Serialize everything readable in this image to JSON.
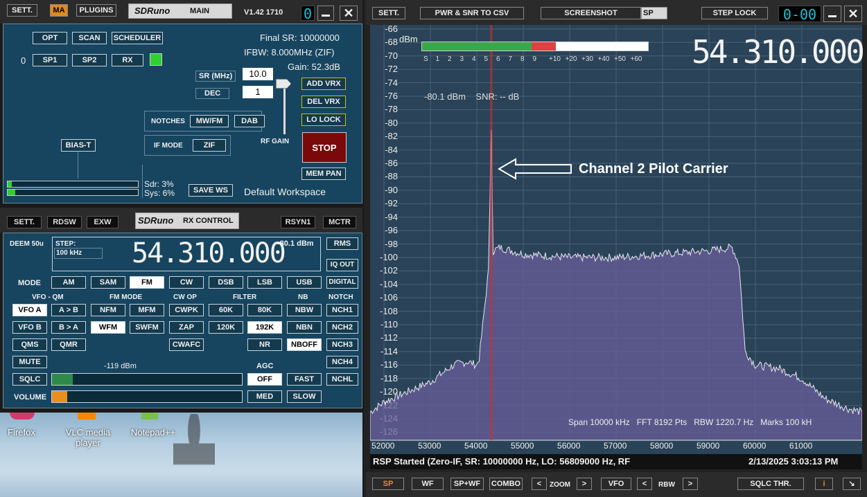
{
  "main": {
    "sett": "SETT.",
    "ma": "MA",
    "plugins": "PLUGINS",
    "logo": "SDRuno",
    "title": "MAIN",
    "version": "V1.42 1710",
    "counter": "0",
    "opt": "OPT",
    "scan": "SCAN",
    "scheduler": "SCHEDULER",
    "index": "0",
    "sp1": "SP1",
    "sp2": "SP2",
    "rx": "RX",
    "final_sr": "Final SR: 10000000",
    "ifbw": "IFBW: 8.000MHz (ZIF)",
    "gain": "Gain: 52.3dB",
    "sr_label": "SR (MHz)",
    "sr_value": "10.0",
    "dec_label": "DEC",
    "dec_value": "1",
    "add_vrx": "ADD VRX",
    "del_vrx": "DEL VRX",
    "lo_lock": "LO LOCK",
    "notches": "NOTCHES",
    "mwfm": "MW/FM",
    "dab": "DAB",
    "ifmode": "IF MODE",
    "zif": "ZIF",
    "rf_gain": "RF GAIN",
    "stop": "STOP",
    "bias_t": "BIAS-T",
    "mem_pan": "MEM PAN",
    "sdr_usage": "Sdr: 3%",
    "sys_usage": "Sys: 6%",
    "save_ws": "SAVE WS",
    "workspace": "Default Workspace"
  },
  "rxc": {
    "sett": "SETT.",
    "rdsw": "RDSW",
    "exw": "EXW",
    "logo": "SDRuno",
    "title": "RX CONTROL",
    "rsyn1": "RSYN1",
    "mctr": "MCTR",
    "deem": "DEEM 50u",
    "step_label": "STEP:",
    "step_value": "100 kHz",
    "freq": "54.310.000",
    "level": "-80.1 dBm",
    "rms": "RMS",
    "iq_out": "IQ OUT",
    "digital": "DIGITAL",
    "mode_label": "MODE",
    "modes": [
      "AM",
      "SAM",
      "FM",
      "CW",
      "DSB",
      "LSB",
      "USB"
    ],
    "h_vfo_qm": "VFO - QM",
    "h_fm_mode": "FM MODE",
    "h_cw_op": "CW OP",
    "h_filter": "FILTER",
    "h_nb": "NB",
    "h_notch": "NOTCH",
    "vfo_a": "VFO A",
    "a_to_b": "A > B",
    "nfm": "NFM",
    "mfm": "MFM",
    "cwpk": "CWPK",
    "f60k": "60K",
    "f80k": "80K",
    "nbw": "NBW",
    "nch1": "NCH1",
    "vfo_b": "VFO B",
    "b_to_a": "B > A",
    "wfm": "WFM",
    "swfm": "SWFM",
    "zap": "ZAP",
    "f120k": "120K",
    "f192k": "192K",
    "nbn": "NBN",
    "nch2": "NCH2",
    "qms": "QMS",
    "qmr": "QMR",
    "cwafc": "CWAFC",
    "nr": "NR",
    "nboff": "NBOFF",
    "nch3": "NCH3",
    "mute": "MUTE",
    "sq_level": "-119 dBm",
    "agc": "AGC",
    "nch4": "NCH4",
    "sqlc": "SQLC",
    "agc_off": "OFF",
    "agc_fast": "FAST",
    "nchl": "NCHL",
    "volume": "VOLUME",
    "agc_med": "MED",
    "agc_slow": "SLOW"
  },
  "desktop": {
    "firefox": "Firefox",
    "vlc": "VLC media player",
    "notepad": "Notepad++"
  },
  "sp": {
    "sett": "SETT.",
    "pwr_snr": "PWR & SNR TO CSV",
    "screenshot": "SCREENSHOT",
    "sp_tag": "SP",
    "step_lock": "STEP LOCK",
    "counter": "0-00",
    "dbm_unit": "dBm",
    "big_freq": "54.310.000",
    "signal_readout": "-80.1 dBm    SNR: -- dB",
    "annotation": "Channel 2 Pilot Carrier",
    "smeter_labels": [
      "S",
      "1",
      "2",
      "3",
      "4",
      "5",
      "6",
      "7",
      "8",
      "9",
      "+10",
      "+20",
      "+30",
      "+40",
      "+50",
      "+60"
    ],
    "y_ticks": [
      "-66",
      "-68",
      "-70",
      "-72",
      "-74",
      "-76",
      "-78",
      "-80",
      "-82",
      "-84",
      "-86",
      "-88",
      "-90",
      "-92",
      "-94",
      "-96",
      "-98",
      "-100",
      "-102",
      "-104",
      "-106",
      "-108",
      "-110",
      "-112",
      "-114",
      "-116",
      "-118",
      "-120",
      "-122",
      "-124",
      "-126"
    ],
    "x_ticks": [
      "52000",
      "53000",
      "54000",
      "55000",
      "56000",
      "57000",
      "58000",
      "59000",
      "60000",
      "61000"
    ],
    "info": "Span 10000 kHz   FFT 8192 Pts   RBW 1220.7 Hz   Marks 100 kH",
    "status": "RSP Started (Zero-IF, SR: 10000000 Hz, LO: 56809000 Hz, RF",
    "datetime": "2/13/2025 3:03:13 PM",
    "b_sp": "SP",
    "b_wf": "WF",
    "b_spwf": "SP+WF",
    "b_combo": "COMBO",
    "zoom": "ZOOM",
    "b_vfo": "VFO",
    "rbw": "RBW",
    "sqlc_thr": "SQLC THR.",
    "info_btn": "i"
  },
  "chart_data": {
    "type": "area",
    "title": "",
    "xlabel": "",
    "ylabel": "dBm",
    "x_unit": "kHz",
    "xlim": [
      51700,
      62300
    ],
    "ylim": [
      -126,
      -66
    ],
    "grid": true,
    "series": [
      {
        "x": [
          51700,
          52000,
          52500,
          53000,
          53500,
          53800,
          54000,
          54050,
          54250,
          54310,
          54350,
          54500,
          55000,
          56000,
          57000,
          58000,
          59000,
          59500,
          59650,
          59780,
          60000,
          60500,
          61000,
          61500,
          62000,
          62300
        ],
        "values": [
          -123,
          -121.5,
          -120,
          -118.5,
          -116,
          -115.5,
          -116,
          -115,
          -102,
          -81,
          -99,
          -98.5,
          -99.5,
          -100,
          -100,
          -99.5,
          -99,
          -98.5,
          -101,
          -114,
          -116,
          -116.5,
          -118,
          -121,
          -122.5,
          -123
        ]
      }
    ],
    "marker_freq_khz": 54310
  }
}
